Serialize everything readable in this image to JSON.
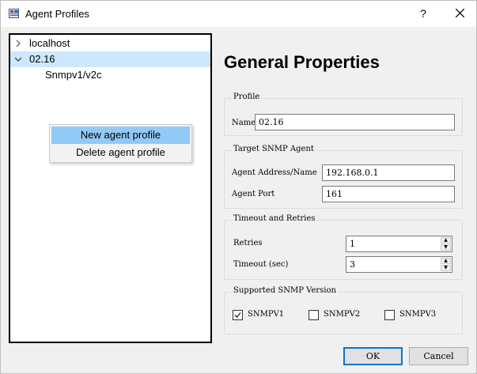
{
  "window": {
    "title": "Agent Profiles",
    "help": "?"
  },
  "tree": {
    "items": [
      {
        "label": "localhost",
        "expanded": false
      },
      {
        "label": "02.16",
        "expanded": true,
        "selected": true
      },
      {
        "label": "Snmpv1/v2c"
      }
    ]
  },
  "context_menu": {
    "items": [
      {
        "label": "New agent profile",
        "highlighted": true
      },
      {
        "label": "Delete agent profile"
      }
    ]
  },
  "props": {
    "title": "General Properties",
    "profile": {
      "group": "Profile",
      "name_label": "Name",
      "name_value": "02.16"
    },
    "target": {
      "group": "Target SNMP Agent",
      "address_label": "Agent Address/Name",
      "address_value": "192.168.0.1",
      "port_label": "Agent Port",
      "port_value": "161"
    },
    "timeout": {
      "group": "Timeout and Retries",
      "retries_label": "Retries",
      "retries_value": "1",
      "timeout_label": "Timeout (sec)",
      "timeout_value": "3"
    },
    "version": {
      "group": "Supported SNMP Version",
      "options": [
        {
          "label": "SNMPV1",
          "checked": true
        },
        {
          "label": "SNMPV2",
          "checked": false
        },
        {
          "label": "SNMPV3",
          "checked": false
        }
      ]
    }
  },
  "buttons": {
    "ok": "OK",
    "cancel": "Cancel"
  },
  "colors": {
    "selection": "#cce8ff",
    "menu_highlight": "#91c9f7",
    "default_border": "#0078d7"
  }
}
